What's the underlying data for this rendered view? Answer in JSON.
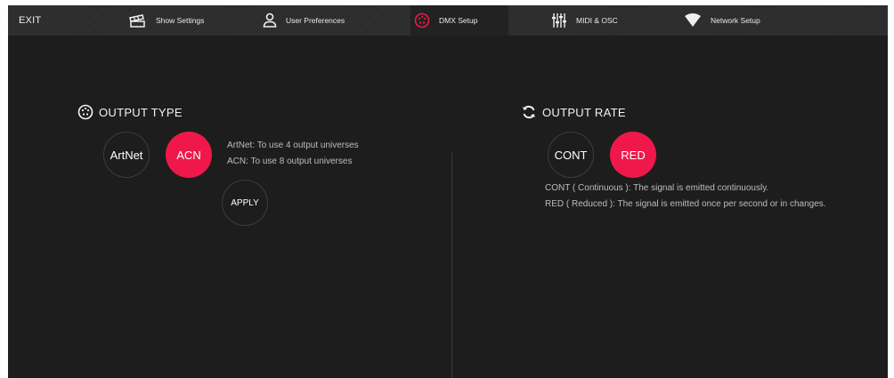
{
  "topbar": {
    "exit_label": "EXIT",
    "tabs": [
      {
        "label": "Show Settings",
        "icon": "show-settings-icon",
        "active": false
      },
      {
        "label": "User Preferences",
        "icon": "user-icon",
        "active": false
      },
      {
        "label": "DMX Setup",
        "icon": "dmx-connector-icon",
        "active": true
      },
      {
        "label": "MIDI & OSC",
        "icon": "sliders-icon",
        "active": false
      },
      {
        "label": "Network Setup",
        "icon": "wifi-icon",
        "active": false
      }
    ]
  },
  "output_type": {
    "title": "OUTPUT TYPE",
    "icon": "dmx-connector-icon",
    "options": [
      {
        "label": "ArtNet",
        "selected": false
      },
      {
        "label": "ACN",
        "selected": true
      }
    ],
    "info_lines": [
      "ArtNet: To use 4 output universes",
      "ACN: To use 8 output universes"
    ],
    "apply_label": "APPLY"
  },
  "output_rate": {
    "title": "OUTPUT RATE",
    "icon": "refresh-icon",
    "options": [
      {
        "label": "CONT",
        "selected": false
      },
      {
        "label": "RED",
        "selected": true
      }
    ],
    "info_lines": [
      "CONT ( Continuous ): The signal is emitted continuously.",
      "RED ( Reduced ): The signal is emitted once per second or in changes."
    ]
  },
  "colors": {
    "accent": "#f0184a",
    "background": "#1d1d1d",
    "topbar": "#2a2a2a",
    "text": "#f2f2f2",
    "muted_text": "#bdbdbd"
  }
}
